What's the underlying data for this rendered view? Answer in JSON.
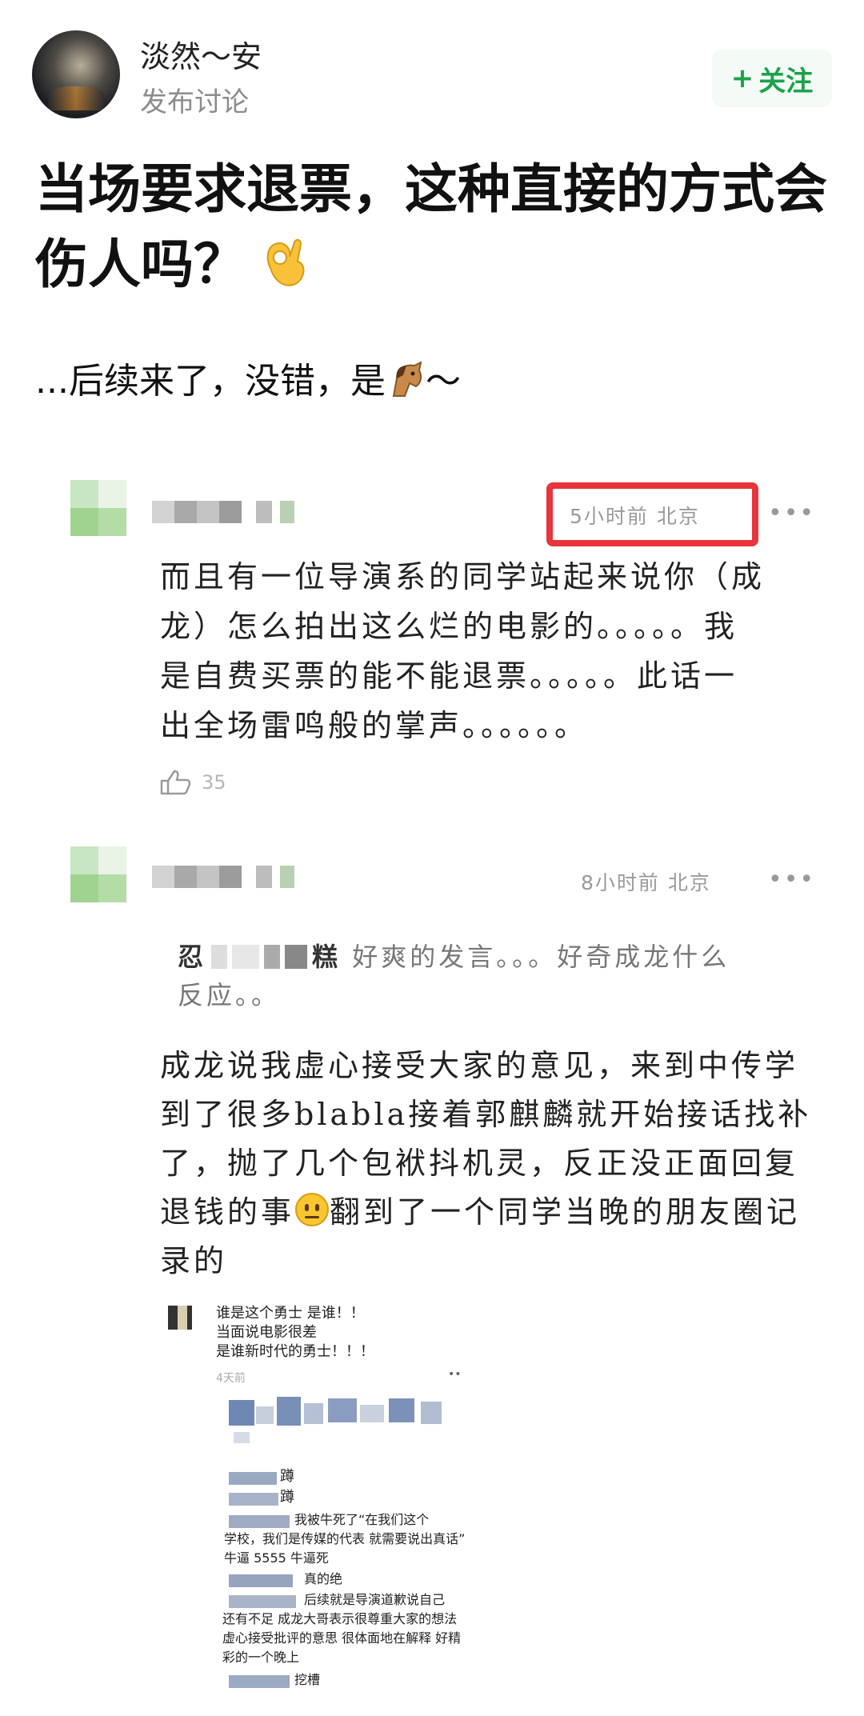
{
  "post": {
    "author": "淡然～安",
    "subtitle": "发布讨论",
    "follow_label": "关注",
    "title": "当场要求退票，这种直接的方式会伤人吗？",
    "intro_text": "...后续来了，没错，是",
    "intro_tail": "～"
  },
  "comments": [
    {
      "meta": "5小时前 北京",
      "more": "•••",
      "lines": [
        "而且有一位导演系的同学站起来说你（成",
        "龙）怎么拍出这么烂的电影的。。。。。我",
        "是自费买票的能不能退票。。。。。此话一",
        "出全场雷鸣般的掌声。。。。。。"
      ],
      "likes": "35"
    },
    {
      "meta": "8小时前 北京",
      "more": "•••",
      "quote_name": "忍",
      "quote_name2": "糕",
      "quote_line1": "好爽的发言。。。好奇成龙什么",
      "quote_line2": "反应。。",
      "lines": [
        "成龙说我虚心接受大家的意见，来到中传学",
        "到了很多blabla接着郭麒麟就开始接话找补",
        "了，抛了几个包袱抖机灵，反正没正面回复"
      ],
      "line4a": "退钱的事",
      "line4b": "翻到了一个同学当晚的朋友圈记",
      "line5": "录的"
    }
  ],
  "moments": {
    "l1": "谁是这个勇士 是谁！！",
    "l2": "当面说电影很差",
    "l3": "是谁新时代的勇士！！！",
    "time": "4天前",
    "more": "••",
    "r1": "蹲",
    "r2": "蹲",
    "r3": "我被牛死了“在我们这个",
    "r4": "学校，我们是传媒的代表 就需要说出真话”",
    "r5": "牛逼 5555 牛逼死",
    "r6": "真的绝",
    "r7": "后续就是导演道歉说自己",
    "r8": "还有不足 成龙大哥表示很尊重大家的想法",
    "r9": "虚心接受批评的意思 很体面地在解释 好精",
    "r10": "彩的一个晚上",
    "r11": "挖槽"
  }
}
